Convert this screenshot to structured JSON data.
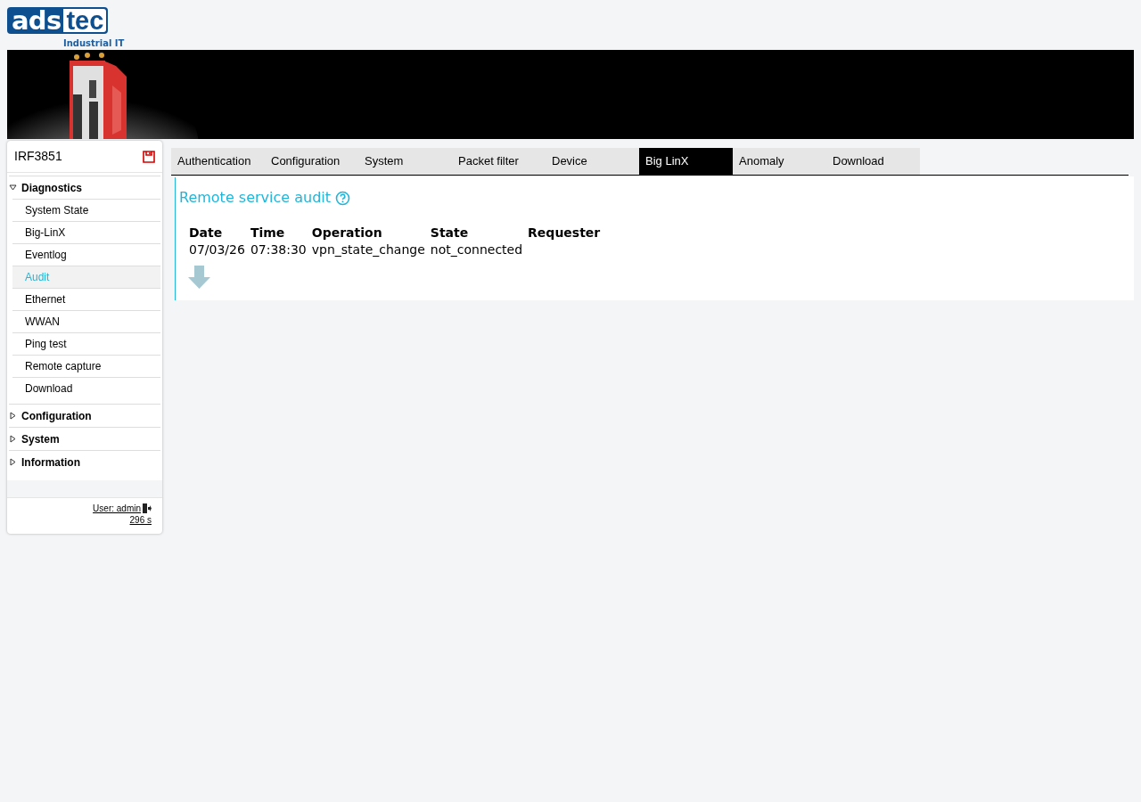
{
  "logo": {
    "part_1": "ads",
    "part_2": "tec",
    "tagline": "Industrial IT"
  },
  "sidebar": {
    "device": "IRF3851",
    "groups": [
      {
        "label": "Diagnostics",
        "expanded": true,
        "children": [
          {
            "label": "System State",
            "selected": false
          },
          {
            "label": "Big-LinX",
            "selected": false
          },
          {
            "label": "Eventlog",
            "selected": false
          },
          {
            "label": "Audit",
            "selected": true
          },
          {
            "label": "Ethernet",
            "selected": false
          },
          {
            "label": "WWAN",
            "selected": false
          },
          {
            "label": "Ping test",
            "selected": false
          },
          {
            "label": "Remote capture",
            "selected": false
          },
          {
            "label": "Download",
            "selected": false
          }
        ]
      },
      {
        "label": "Configuration",
        "expanded": false
      },
      {
        "label": "System",
        "expanded": false
      },
      {
        "label": "Information",
        "expanded": false
      }
    ],
    "user": "User: admin",
    "timer": "296 s"
  },
  "tabs": [
    {
      "label": "Authentication",
      "selected": false
    },
    {
      "label": "Configuration",
      "selected": false
    },
    {
      "label": "System",
      "selected": false
    },
    {
      "label": "Packet filter",
      "selected": false
    },
    {
      "label": "Device",
      "selected": false
    },
    {
      "label": "Big LinX",
      "selected": true
    },
    {
      "label": "Anomaly",
      "selected": false
    },
    {
      "label": "Download",
      "selected": false
    }
  ],
  "panel": {
    "title": "Remote service audit",
    "table": {
      "columns": [
        "Date",
        "Time",
        "Operation",
        "State",
        "Requester"
      ],
      "rows": [
        [
          "07/03/26",
          "07:38:30",
          "vpn_state_change",
          "not_connected",
          ""
        ]
      ]
    }
  }
}
